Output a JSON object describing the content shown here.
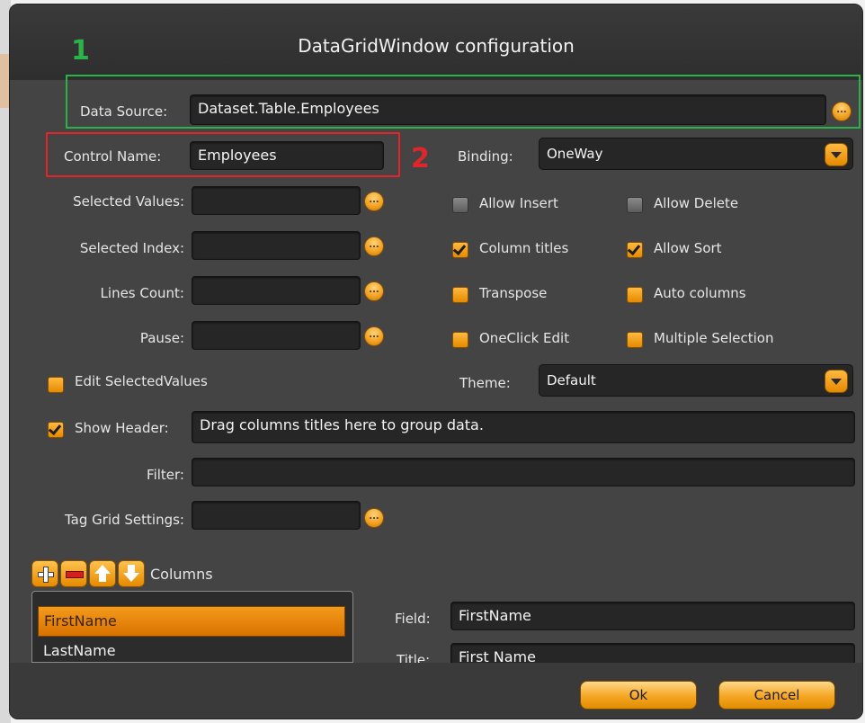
{
  "window": {
    "title": "DataGridWindow configuration"
  },
  "annotations": {
    "num1": "1",
    "num2": "2",
    "box1_color": "#2bb34a",
    "box2_color": "#e0262b"
  },
  "fields": {
    "data_source": {
      "label": "Data Source:",
      "value": "Dataset.Table.Employees"
    },
    "control_name": {
      "label": "Control Name:",
      "value": "Employees"
    },
    "binding": {
      "label": "Binding:",
      "value": "OneWay"
    },
    "selected_values": {
      "label": "Selected Values:",
      "value": ""
    },
    "selected_index": {
      "label": "Selected Index:",
      "value": ""
    },
    "lines_count": {
      "label": "Lines Count:",
      "value": ""
    },
    "pause": {
      "label": "Pause:",
      "value": ""
    },
    "theme": {
      "label": "Theme:",
      "value": "Default"
    },
    "show_header": {
      "label": "Show Header:",
      "value": "Drag columns titles here to group data."
    },
    "filter": {
      "label": "Filter:",
      "value": ""
    },
    "tag_grid_settings": {
      "label": "Tag Grid Settings:",
      "value": ""
    },
    "field": {
      "label": "Field:",
      "value": "FirstName"
    },
    "title": {
      "label": "Title:",
      "value": "First Name"
    }
  },
  "checkboxes": {
    "allow_insert": {
      "label": "Allow Insert",
      "checked": false
    },
    "allow_delete": {
      "label": "Allow Delete",
      "checked": false
    },
    "column_titles": {
      "label": "Column titles",
      "checked": true
    },
    "allow_sort": {
      "label": "Allow Sort",
      "checked": true
    },
    "transpose": {
      "label": "Transpose",
      "checked": false
    },
    "auto_columns": {
      "label": "Auto columns",
      "checked": false
    },
    "oneclick_edit": {
      "label": "OneClick Edit",
      "checked": false
    },
    "multiple_selection": {
      "label": "Multiple Selection",
      "checked": false
    },
    "edit_selected_values": {
      "label": "Edit SelectedValues",
      "checked": false
    },
    "show_header": {
      "checked": true
    }
  },
  "columns": {
    "header": "Columns",
    "items": [
      "FirstName",
      "LastName"
    ],
    "selected": "FirstName",
    "toolbar": [
      "plus-icon",
      "minus-icon",
      "arrow-up-icon",
      "arrow-down-icon"
    ]
  },
  "buttons": {
    "ok": "Ok",
    "cancel": "Cancel"
  },
  "colors": {
    "accent": "#f0a020",
    "background": "#444444",
    "field": "#262626"
  },
  "icons": {
    "ellipsis": "...",
    "dropdown": "chevron-down-icon"
  }
}
